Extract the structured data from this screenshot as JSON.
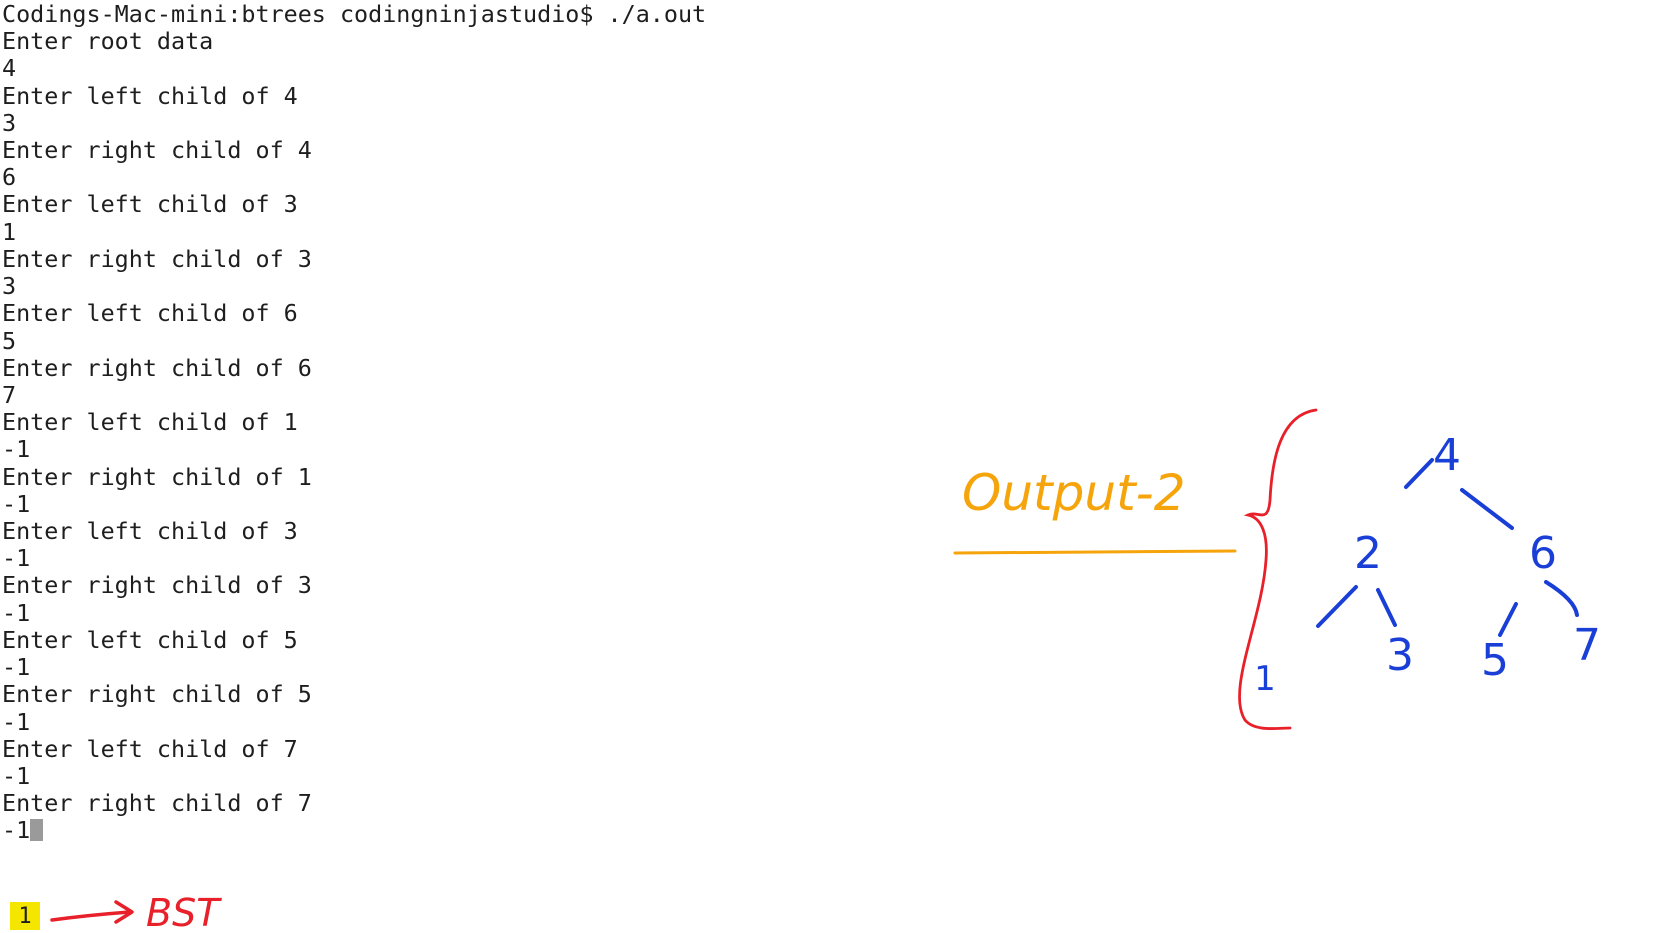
{
  "terminal": {
    "lines": [
      "Codings-Mac-mini:btrees codingninjastudio$ ./a.out",
      "Enter root data",
      "4",
      "Enter left child of 4",
      "3",
      "Enter right child of 4",
      "6",
      "Enter left child of 3",
      "1",
      "Enter right child of 3",
      "3",
      "Enter left child of 6",
      "5",
      "Enter right child of 6",
      "7",
      "Enter left child of 1",
      "-1",
      "Enter right child of 1",
      "-1",
      "Enter left child of 3",
      "-1",
      "Enter right child of 3",
      "-1",
      "Enter left child of 5",
      "-1",
      "Enter right child of 5",
      "-1",
      "Enter left child of 7",
      "-1",
      "Enter right child of 7",
      "-1"
    ],
    "result": "1"
  },
  "annotations": {
    "result_note": "BST",
    "output_label": "Output-2",
    "tree_nodes": [
      "4",
      "2",
      "6",
      "1",
      "3",
      "5",
      "7"
    ],
    "colors": {
      "terminal_text": "#1e1e1e",
      "result_highlight": "#f5e600",
      "red_ink": "#e8202a",
      "orange_ink": "#f5a40c",
      "blue_ink": "#1a3fd6"
    }
  }
}
